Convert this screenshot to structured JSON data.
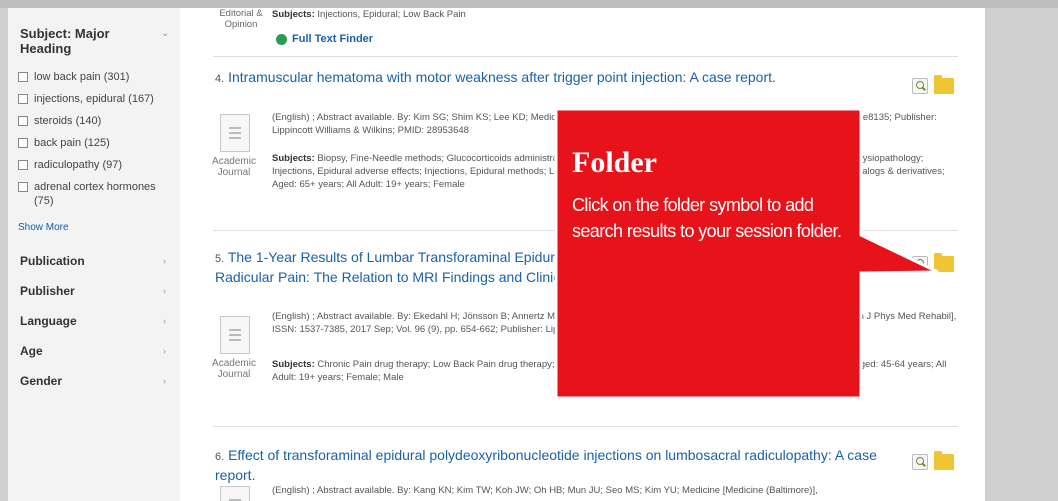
{
  "sidebar": {
    "heading": "Subject: Major Heading",
    "facets": [
      {
        "label": "low back pain (301)"
      },
      {
        "label": "injections, epidural (167)"
      },
      {
        "label": "steroids (140)"
      },
      {
        "label": "back pain (125)"
      },
      {
        "label": "radiculopathy (97)"
      },
      {
        "label": "adrenal cortex hormones (75)"
      }
    ],
    "show_more": "Show More",
    "sections": [
      "Publication",
      "Publisher",
      "Language",
      "Age",
      "Gender"
    ]
  },
  "top_partial": {
    "ptype": "Editorial & Opinion",
    "subjects_label": "Subjects:",
    "subjects": "Injections, Epidural; Low Back Pain",
    "full_text_finder": "Full Text Finder"
  },
  "results": [
    {
      "number": "4.",
      "title": "Intramuscular hematoma with motor weakness after trigger point injection: A case report.",
      "meta": "(English) ; Abstract available. By: Kim SG; Shim KS; Lee KD; Medicine [Medicine (Baltimore)], ISSN: 1536-5964, 2017 Sep; Vol. 96 (39), pp. e8135; Publisher: Lippincott Williams & Wilkins; PMID: 28953648",
      "subjects_label": "Subjects:",
      "subjects": "Biopsy, Fine-Needle methods; Glucocorticoids administration & dosage; Hematoma diagnosis; Hematoma etiology; Hematoma physiopathology; Injections, Epidural adverse effects; Injections, Epidural methods; Low Back Pain drug therapy; Spinal Stenosis complications; Ticlopidine analogs & derivatives; Aged: 65+ years; All Adult: 19+ years; Female",
      "ptype": "Academic Journal"
    },
    {
      "number": "5.",
      "title": "The 1-Year Results of Lumbar Transforaminal Epidural Steroid Injection in Patients with Chronic Unilateral Radicular Pain: The Relation to MRI Findings and Clinical Features.",
      "meta": "(English) ; Abstract available. By: Ekedahl H; Jönsson B; Annertz M; Frobell RB; American Journal Of Physical Medicine & Rehabilitation [Am J Phys Med Rehabil], ISSN: 1537-7385, 2017 Sep; Vol. 96 (9), pp. 654-662; Publisher: Lippincott Williams & Wilkins; PMID: 28257294",
      "subjects_label": "Subjects:",
      "subjects": "Chronic Pain drug therapy; Low Back Pain drug therapy; Radiculopathy drug therapy; Steroids administration & dosage; Middle Aged: 45-64 years; All Adult: 19+ years; Female; Male",
      "ptype": "Academic Journal"
    },
    {
      "number": "6.",
      "title": "Effect of transforaminal epidural polydeoxyribonucleotide injections on lumbosacral radiculopathy: A case report.",
      "meta": "(English) ; Abstract available. By: Kang KN; Kim TW; Koh JW; Oh HB; Mun JU; Seo MS; Kim YU; Medicine [Medicine (Baltimore)],"
    }
  ],
  "callout": {
    "title": "Folder",
    "body": "Click on the folder symbol to add search results to your session folder.",
    "fill": "#e8121a",
    "stroke": "#ffffff"
  }
}
